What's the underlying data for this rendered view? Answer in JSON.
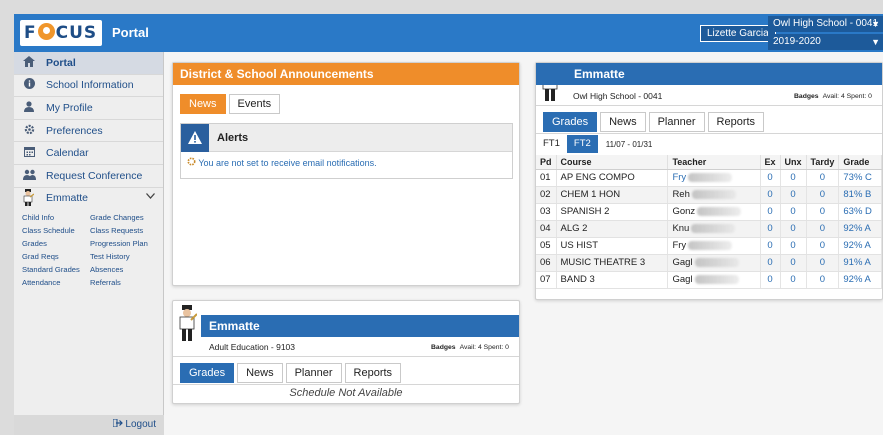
{
  "header": {
    "logo_text_left": "F",
    "logo_text_right": "CUS",
    "portal_title": "Portal",
    "user_name": "Lizette Garcia",
    "school": "Owl High School - 0041",
    "year": "2019-2020",
    "bar_color": "#2a79c7"
  },
  "sidebar": {
    "items": [
      {
        "label": "Portal",
        "icon": "home-icon"
      },
      {
        "label": "School Information",
        "icon": "info-icon"
      },
      {
        "label": "My Profile",
        "icon": "user-icon"
      },
      {
        "label": "Preferences",
        "icon": "gear-icon"
      },
      {
        "label": "Calendar",
        "icon": "calendar-icon"
      },
      {
        "label": "Request Conference",
        "icon": "users-icon"
      }
    ],
    "student": "Emmatte",
    "sublinks": [
      "Child Info",
      "Grade Changes",
      "Class Schedule",
      "Class Requests",
      "Grades",
      "Progression Plan",
      "Grad Reqs",
      "Test History",
      "Standard Grades",
      "Absences",
      "Attendance",
      "Referrals"
    ],
    "logout": "Logout"
  },
  "announcements": {
    "title": "District & School Announcements",
    "tabs": [
      "News",
      "Events"
    ],
    "alerts_title": "Alerts",
    "alert_message": "You are not set to receive email notifications."
  },
  "grades_card": {
    "student": "Emmatte",
    "school": "Owl High School - 0041",
    "badges_label": "Badges",
    "avail": "Avail: 4",
    "spent": "Spent: 0",
    "tabs": [
      "Grades",
      "News",
      "Planner",
      "Reports"
    ],
    "marking_periods": [
      "FT1",
      "FT2"
    ],
    "date_range": "11/07 - 01/31",
    "columns": [
      "Pd",
      "Course",
      "Teacher",
      "Ex",
      "Unx",
      "Tardy",
      "Grade"
    ],
    "rows": [
      {
        "pd": "01",
        "course": "AP ENG COMPO",
        "teacher": "Fry",
        "ex": "0",
        "unx": "0",
        "tardy": "0",
        "grade": "73% C"
      },
      {
        "pd": "02",
        "course": "CHEM 1 HON",
        "teacher": "Reh",
        "ex": "0",
        "unx": "0",
        "tardy": "0",
        "grade": "81% B"
      },
      {
        "pd": "03",
        "course": "SPANISH 2",
        "teacher": "Gonz",
        "ex": "0",
        "unx": "0",
        "tardy": "0",
        "grade": "63% D"
      },
      {
        "pd": "04",
        "course": "ALG 2",
        "teacher": "Knu",
        "ex": "0",
        "unx": "0",
        "tardy": "0",
        "grade": "92% A"
      },
      {
        "pd": "05",
        "course": "US HIST",
        "teacher": "Fry",
        "ex": "0",
        "unx": "0",
        "tardy": "0",
        "grade": "92% A"
      },
      {
        "pd": "06",
        "course": "MUSIC THEATRE 3",
        "teacher": "Gagl",
        "ex": "0",
        "unx": "0",
        "tardy": "0",
        "grade": "91% A"
      },
      {
        "pd": "07",
        "course": "BAND 3",
        "teacher": "Gagl",
        "ex": "0",
        "unx": "0",
        "tardy": "0",
        "grade": "92% A"
      }
    ]
  },
  "schedule_card": {
    "student": "Emmatte",
    "school": "Adult Education - 9103",
    "badges_label": "Badges",
    "avail": "Avail: 4",
    "spent": "Spent: 0",
    "tabs": [
      "Grades",
      "News",
      "Planner",
      "Reports"
    ],
    "message": "Schedule Not Available"
  }
}
